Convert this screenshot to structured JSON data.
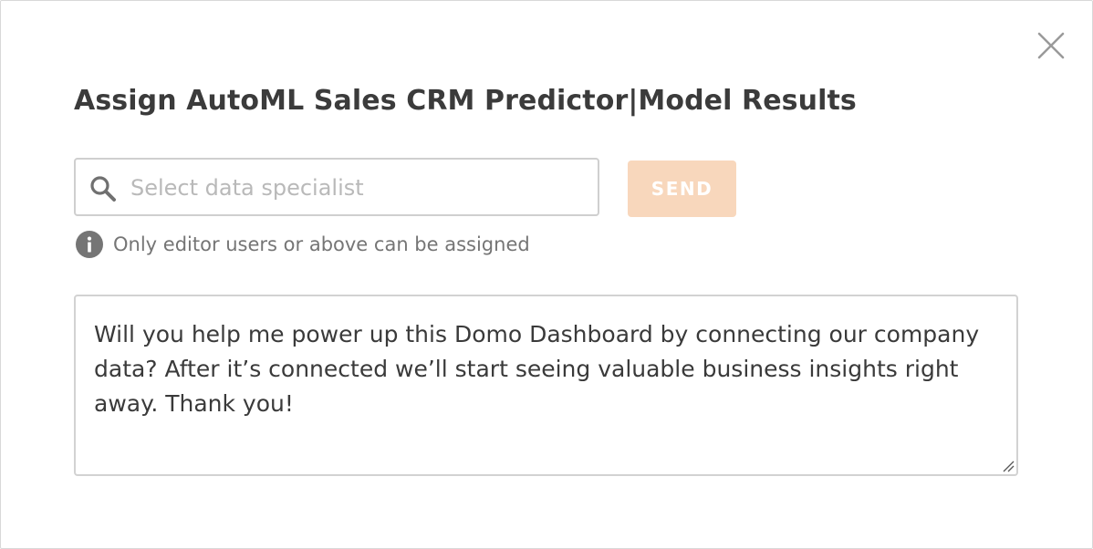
{
  "dialog": {
    "title": "Assign AutoML Sales CRM Predictor|Model Results",
    "close_icon": "close-icon"
  },
  "assignee": {
    "placeholder": "Select data specialist",
    "value": "",
    "icon": "search-icon"
  },
  "send_button": {
    "label": "SEND",
    "enabled": false,
    "color": "#f8d7bc"
  },
  "hint": {
    "icon": "info-icon",
    "text": "Only editor users or above can be assigned"
  },
  "message": {
    "value": "Will you help me power up this Domo Dashboard by connecting our company data? After it’s connected we’ll start seeing valuable business insights right away. Thank you!"
  }
}
